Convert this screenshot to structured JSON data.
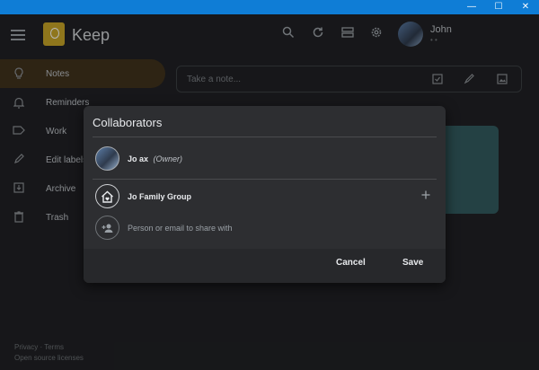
{
  "window": {
    "minimize_glyph": "—",
    "maximize_glyph": "☐",
    "close_glyph": "✕"
  },
  "header": {
    "app_name": "Keep",
    "user_name": "John",
    "user_sub": "• •",
    "icons": [
      "menu-icon",
      "search-icon",
      "refresh-icon",
      "list-view-icon",
      "settings-icon"
    ]
  },
  "sidebar": {
    "items": [
      {
        "label": "Notes",
        "icon": "lightbulb-icon"
      },
      {
        "label": "Reminders",
        "icon": "bell-icon"
      },
      {
        "label": "Work",
        "icon": "label-icon"
      },
      {
        "label": "Edit labels",
        "icon": "pencil-icon"
      },
      {
        "label": "Archive",
        "icon": "archive-icon"
      },
      {
        "label": "Trash",
        "icon": "trash-icon"
      }
    ]
  },
  "footer": {
    "privacy": "Privacy",
    "separator": "·",
    "terms": "Terms",
    "licenses": "Open source licenses"
  },
  "note_bar": {
    "placeholder": "Take a note..."
  },
  "dialog": {
    "title": "Collaborators",
    "owner": {
      "name": "Jo      ax",
      "role": "(Owner)"
    },
    "group": {
      "name": "Jo    Family Group"
    },
    "invite_placeholder": "Person or email to share with",
    "cancel_label": "Cancel",
    "save_label": "Save"
  },
  "colors": {
    "background": "#202124",
    "dialog": "#2d2e31",
    "titlebar": "#0f7dd6",
    "active_nav": "#41331c",
    "note_card": "#335b5f"
  }
}
